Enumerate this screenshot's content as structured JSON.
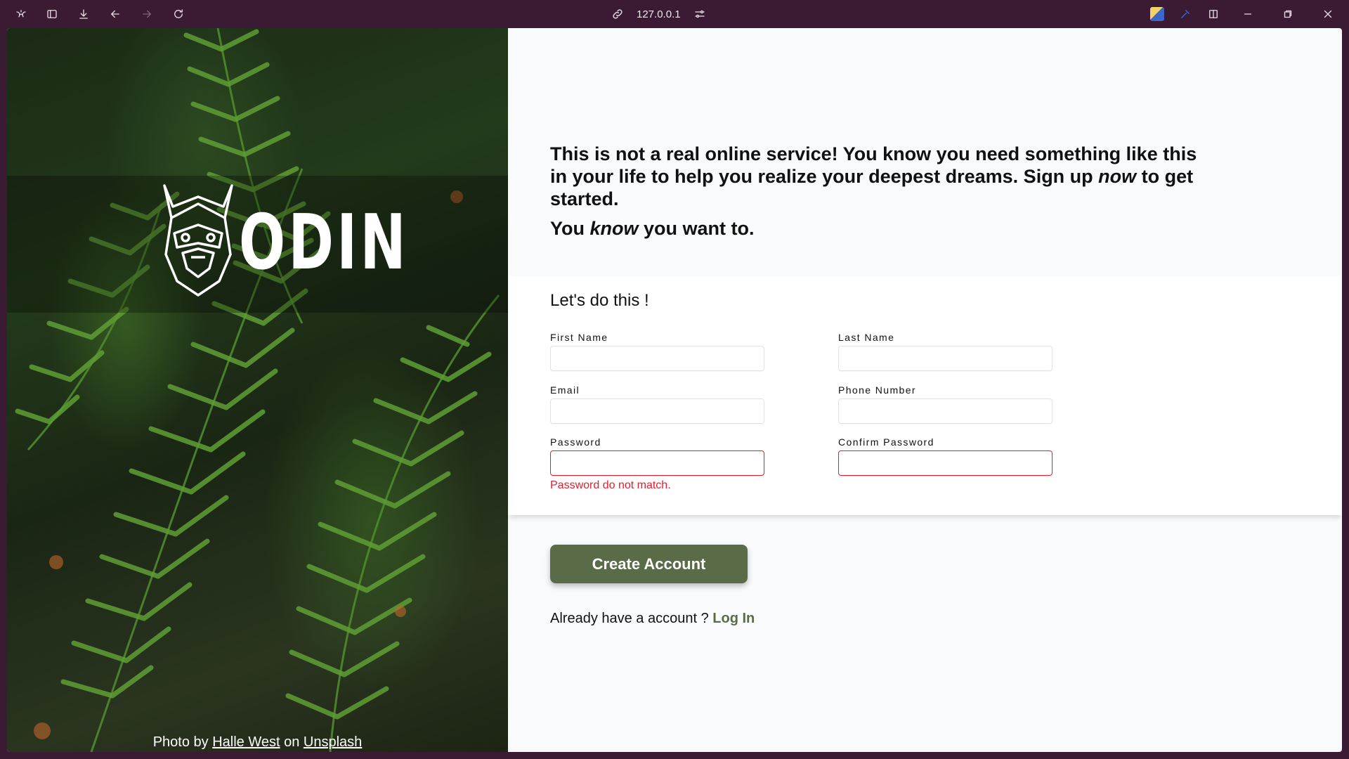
{
  "browser": {
    "url": "127.0.0.1"
  },
  "hero": {
    "logo_text": "ODIN",
    "credit": {
      "prefix": "Photo by",
      "author": "Halle West",
      "middle": "on",
      "site": "Unsplash"
    }
  },
  "intro": {
    "line1_start": "This is not a real online service! You know you need something like this in your life to help you realize your deepest dreams. Sign up ",
    "line1_emph": "now",
    "line1_end": " to get started.",
    "line2_start": "You ",
    "line2_emph": "know",
    "line2_end": " you want to."
  },
  "form": {
    "title": "Let's do this !",
    "fields": {
      "first_name": {
        "label": "First Name",
        "value": ""
      },
      "last_name": {
        "label": "Last Name",
        "value": ""
      },
      "email": {
        "label": "Email",
        "value": ""
      },
      "phone": {
        "label": "Phone Number",
        "value": ""
      },
      "password": {
        "label": "Password",
        "value": ""
      },
      "confirm_password": {
        "label": "Confirm Password",
        "value": ""
      }
    },
    "error": "Password do not match."
  },
  "actions": {
    "create_label": "Create Account",
    "login_prompt": "Already have a account ?",
    "login_link": "Log In"
  },
  "colors": {
    "accent": "#596b47",
    "error": "#e11d2e",
    "chrome": "#3b1a33"
  }
}
